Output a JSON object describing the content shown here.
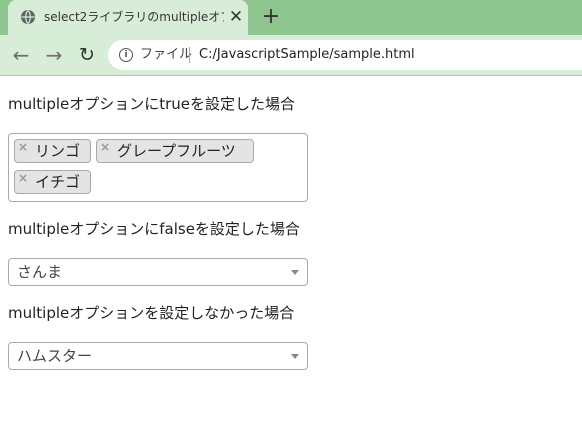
{
  "browser": {
    "tab_title": "select2ライブラリのmultipleオプション",
    "tab_close": "✕",
    "new_tab": "+",
    "back": "←",
    "forward": "→",
    "reload": "↻",
    "info": "i",
    "scheme_label": "ファイル",
    "url": "C:/JavascriptSample/sample.html"
  },
  "sections": {
    "multiple_true": {
      "heading": "multipleオプションにtrueを設定した場合",
      "tags": [
        {
          "remove": "×",
          "label": "リンゴ"
        },
        {
          "remove": "×",
          "label": "グレープフルーツ"
        },
        {
          "remove": "×",
          "label": "イチゴ"
        }
      ]
    },
    "multiple_false": {
      "heading": "multipleオプションにfalseを設定した場合",
      "selected": "さんま"
    },
    "multiple_unset": {
      "heading": "multipleオプションを設定しなかった場合",
      "selected": "ハムスター"
    }
  }
}
